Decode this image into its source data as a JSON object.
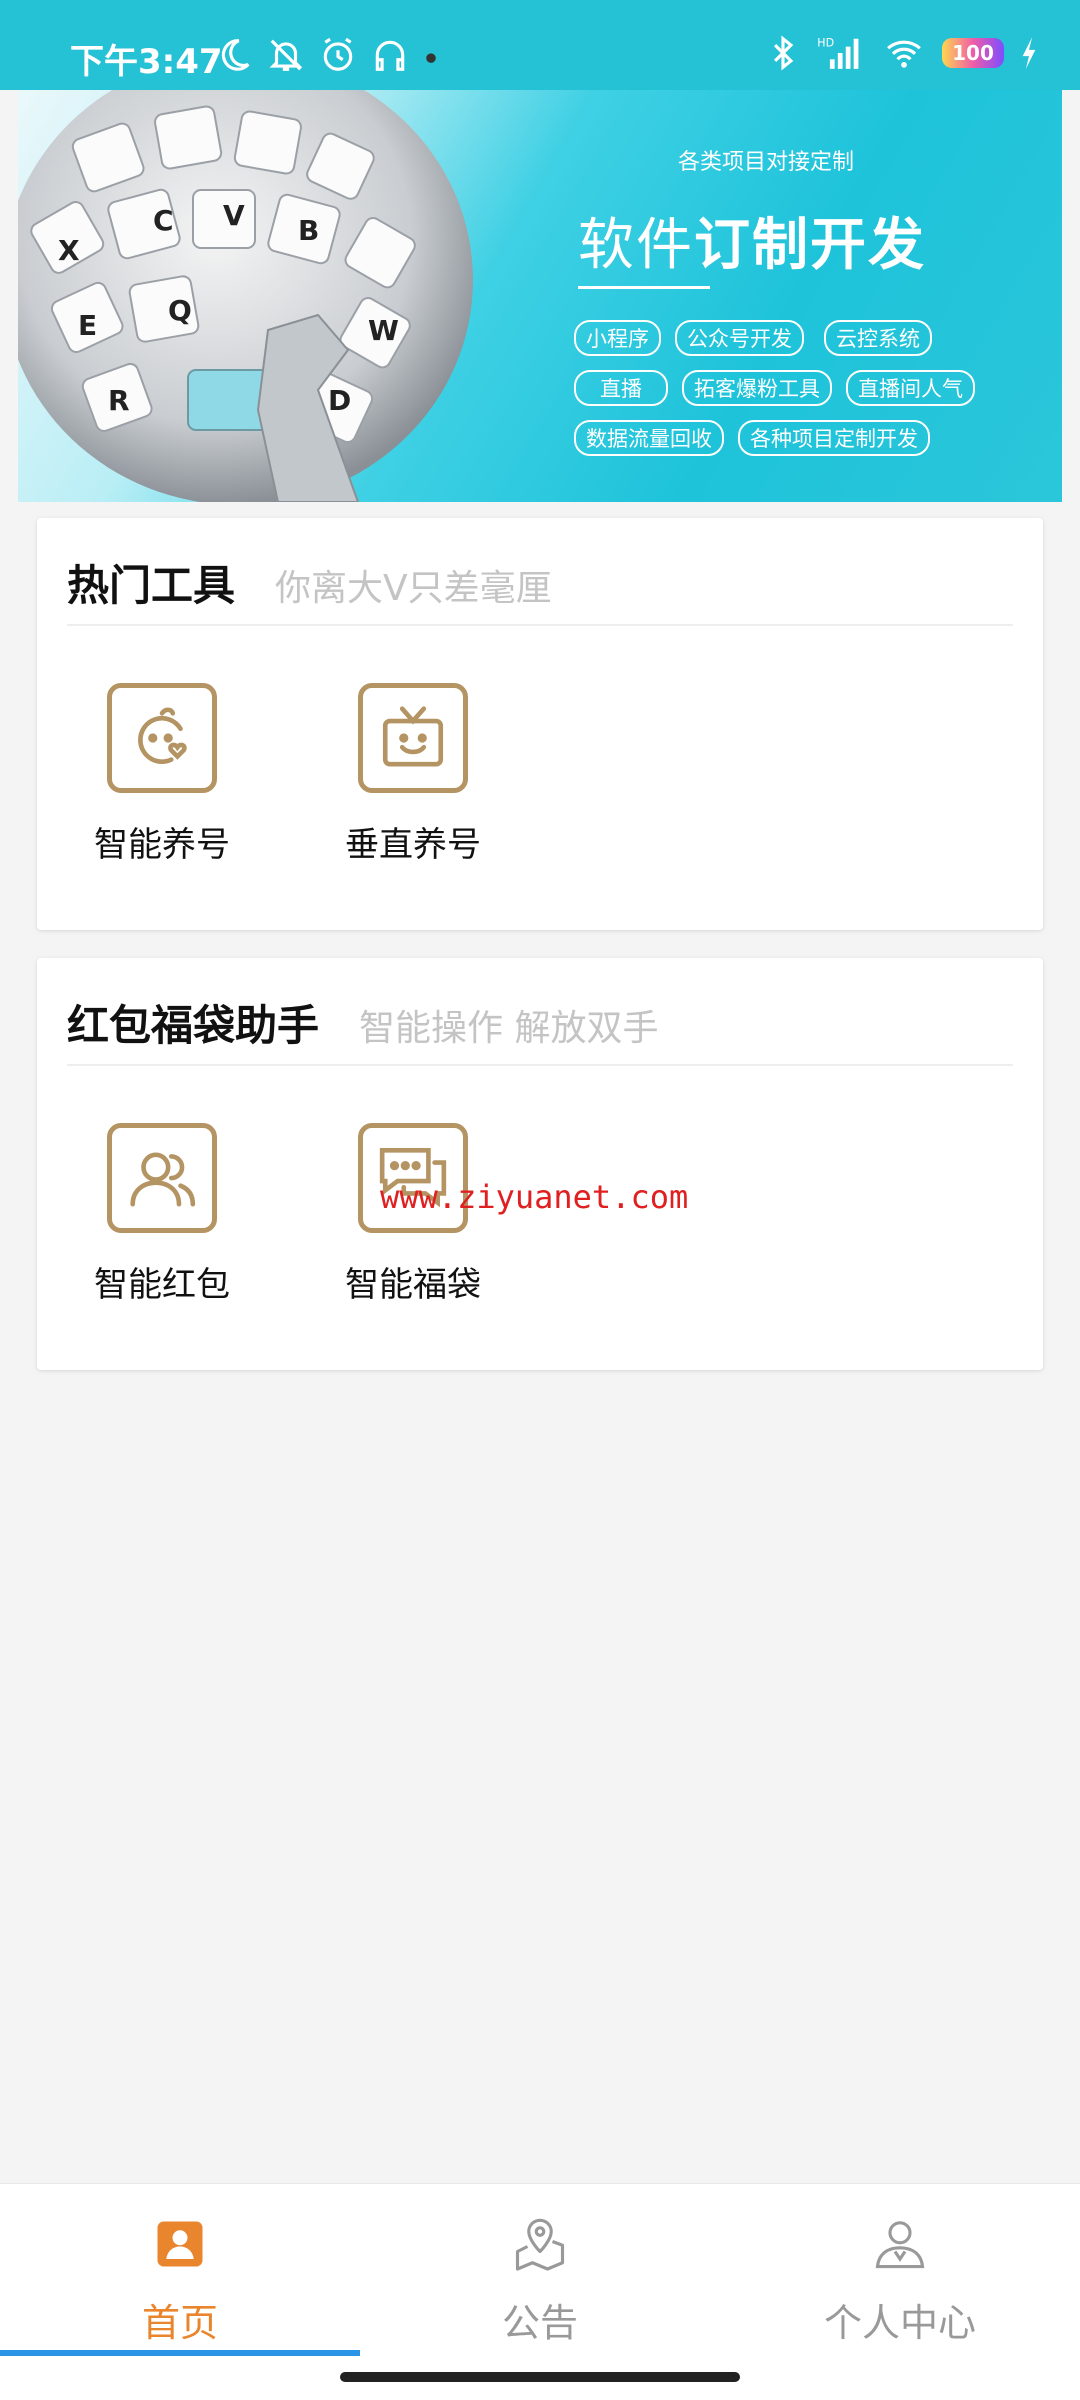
{
  "status_bar": {
    "time": "下午3:47",
    "battery": "100",
    "left_icons": [
      "moon-icon",
      "bell-off-icon",
      "alarm-icon",
      "headphones-icon",
      "notification-dot-icon"
    ],
    "right_icons": [
      "bluetooth-icon",
      "signal-hd-icon",
      "wifi-icon",
      "battery-icon",
      "charging-icon"
    ]
  },
  "banner": {
    "subtitle": "各类项目对接定制",
    "title_light": "软件",
    "title_bold": "订制开发",
    "tag_rows": [
      [
        "小程序",
        "公众号开发",
        "云控系统"
      ],
      [
        "直播",
        "拓客爆粉工具",
        "直播间人气"
      ],
      [
        "数据流量回收",
        "各种项目定制开发"
      ]
    ]
  },
  "hot_tools": {
    "title": "热门工具",
    "subtitle": "你离大V只差毫厘",
    "items": [
      {
        "label": "智能养号",
        "icon": "baby-face-icon"
      },
      {
        "label": "垂直养号",
        "icon": "tv-smile-icon"
      }
    ]
  },
  "redpacket": {
    "title": "红包福袋助手",
    "subtitle": "智能操作 解放双手",
    "items": [
      {
        "label": "智能红包",
        "icon": "users-icon"
      },
      {
        "label": "智能福袋",
        "icon": "chat-bubbles-icon"
      }
    ]
  },
  "watermark": "www.ziyuanet.com",
  "tabbar": {
    "tabs": [
      {
        "label": "首页",
        "icon": "home-profile-icon",
        "active": true
      },
      {
        "label": "公告",
        "icon": "map-pin-icon",
        "active": false
      },
      {
        "label": "个人中心",
        "icon": "user-icon",
        "active": false
      }
    ]
  },
  "colors": {
    "accent": "#e9852c",
    "icon_gold": "#b49463",
    "banner_cyan": "#25c1d4",
    "indicator": "#2a94e6"
  }
}
